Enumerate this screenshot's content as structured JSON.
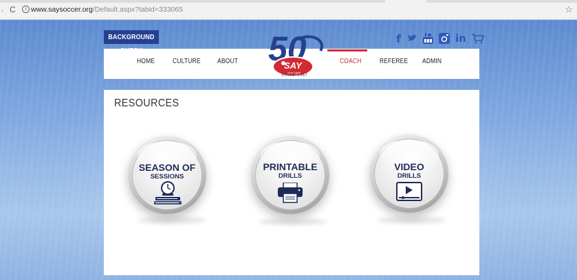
{
  "browser": {
    "url_host": "www.saysoccer.org",
    "url_path": "/Default.aspx?tabid=333065"
  },
  "header": {
    "background_check_label": "BACKGROUND CHECK",
    "logo_text": "SAY",
    "logo_sub": "SOCCER",
    "since_label": "SINCE 1967",
    "anniversary": "50",
    "social_icons": [
      "facebook-icon",
      "twitter-icon",
      "youtube-icon",
      "instagram-icon",
      "linkedin-icon",
      "cart-icon"
    ]
  },
  "nav": {
    "items": [
      {
        "label": "HOME"
      },
      {
        "label": "CULTURE"
      },
      {
        "label": "ABOUT"
      },
      {
        "label": "COACH",
        "active": true
      },
      {
        "label": "REFEREE"
      },
      {
        "label": "ADMIN"
      }
    ]
  },
  "main": {
    "heading": "RESOURCES",
    "resources": [
      {
        "line1": "SEASON OF",
        "line2": "SESSIONS",
        "icon": "clock-books-icon"
      },
      {
        "line1": "PRINTABLE",
        "line2": "DRILLS",
        "icon": "printer-icon"
      },
      {
        "line1": "VIDEO",
        "line2": "DRILLS",
        "icon": "video-player-icon"
      }
    ]
  },
  "colors": {
    "brand_blue": "#25408f",
    "accent_red": "#d42a33",
    "social_blue": "#2f58b7"
  }
}
